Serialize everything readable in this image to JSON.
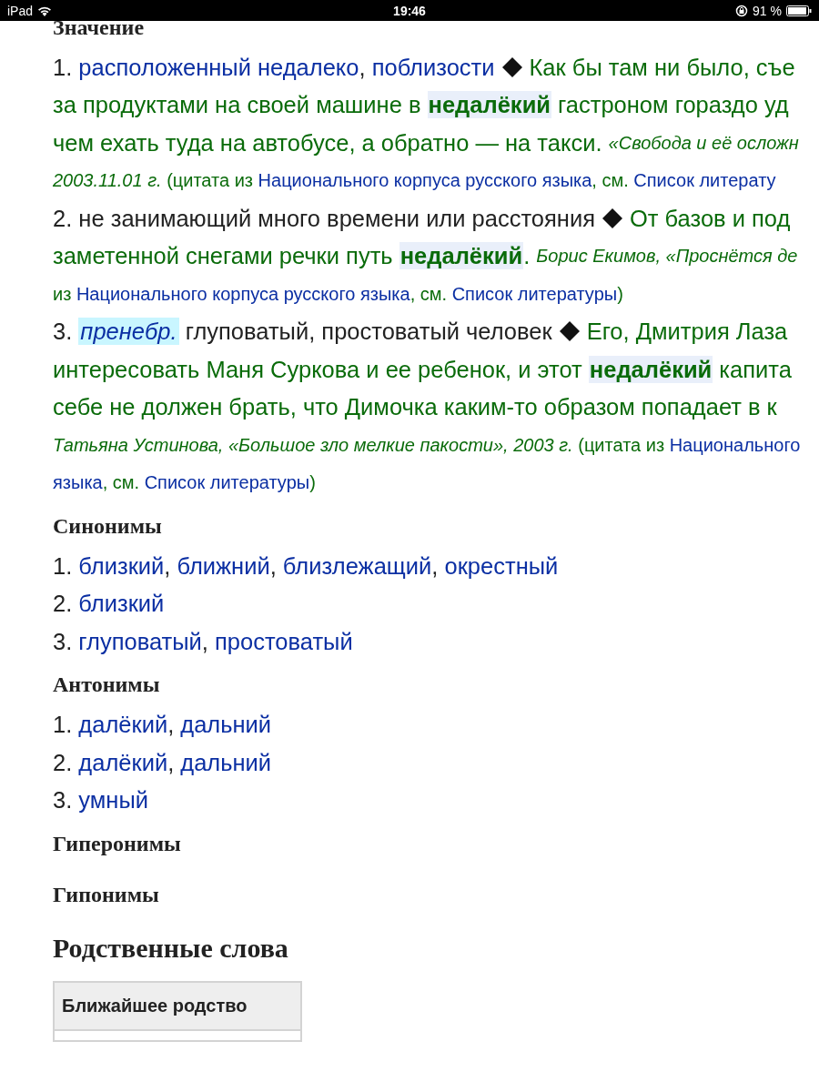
{
  "status_bar": {
    "device": "iPad",
    "time": "19:46",
    "battery": "91 %"
  },
  "sections": [
    {
      "kind": "h3",
      "title": "Значение",
      "lines": [
        {
          "kind": "text",
          "segments": [
            {
              "kind": "plain",
              "text": "1. "
            },
            {
              "kind": "link",
              "text": "расположенный недалеко"
            },
            {
              "kind": "plain",
              "text": ", "
            },
            {
              "kind": "link",
              "text": "поблизости"
            },
            {
              "kind": "marker"
            },
            {
              "kind": "quote",
              "text": "Как бы там ни было, съе"
            }
          ]
        },
        {
          "kind": "text",
          "segments": [
            {
              "kind": "quote",
              "text": "за продуктами на своей машине в "
            },
            {
              "kind": "term",
              "text": "недалёкий"
            },
            {
              "kind": "quote",
              "text": " гастроном гораздо уд"
            }
          ]
        },
        {
          "kind": "text",
          "segments": [
            {
              "kind": "quote",
              "text": "чем ехать туда на автобусе, а обратно — на такси. "
            },
            {
              "kind": "source",
              "text": "«Свобода и её осложн"
            }
          ]
        },
        {
          "kind": "citation",
          "segments": [
            {
              "kind": "source",
              "text": "2003.11.01 г."
            },
            {
              "kind": "quote",
              "text": " (цитата из "
            },
            {
              "kind": "link",
              "text": "Национального корпуса русского языка"
            },
            {
              "kind": "quote",
              "text": ", см. "
            },
            {
              "kind": "link",
              "text": "Список литерату"
            }
          ]
        },
        {
          "kind": "text",
          "segments": [
            {
              "kind": "plain",
              "text": "2. не занимающий много времени или расстояния"
            },
            {
              "kind": "marker"
            },
            {
              "kind": "quote",
              "text": "От базов и под"
            }
          ]
        },
        {
          "kind": "text",
          "segments": [
            {
              "kind": "quote",
              "text": "заметенной снегами речки путь "
            },
            {
              "kind": "term",
              "text": "недалёкий"
            },
            {
              "kind": "quote",
              "text": ". "
            },
            {
              "kind": "source",
              "text": "Борис Екимов, «Проснётся де"
            }
          ]
        },
        {
          "kind": "citation",
          "segments": [
            {
              "kind": "quote",
              "text": "из "
            },
            {
              "kind": "link",
              "text": "Национального корпуса русского языка"
            },
            {
              "kind": "quote",
              "text": ", см. "
            },
            {
              "kind": "link",
              "text": "Список литературы"
            },
            {
              "kind": "quote",
              "text": ")"
            }
          ]
        },
        {
          "kind": "text",
          "segments": [
            {
              "kind": "plain",
              "text": "3. "
            },
            {
              "kind": "label",
              "text": "пренебр."
            },
            {
              "kind": "plain",
              "text": " глуповатый, простоватый человек"
            },
            {
              "kind": "marker"
            },
            {
              "kind": "quote",
              "text": "Его, Дмитрия Лаза"
            }
          ]
        },
        {
          "kind": "text",
          "segments": [
            {
              "kind": "quote",
              "text": "интересовать Маня Суркова и ее ребенок, и этот "
            },
            {
              "kind": "term",
              "text": "недалёкий"
            },
            {
              "kind": "quote",
              "text": " капита"
            }
          ]
        },
        {
          "kind": "text",
          "segments": [
            {
              "kind": "quote",
              "text": "себе не должен брать, что Димочка каким-то образом попадает в к"
            }
          ]
        },
        {
          "kind": "citation",
          "segments": [
            {
              "kind": "source",
              "text": "Татьяна Устинова, «Большое зло мелкие пакости», 2003 г."
            },
            {
              "kind": "quote",
              "text": " (цитата из "
            },
            {
              "kind": "link",
              "text": "Национального"
            }
          ]
        },
        {
          "kind": "citation",
          "segments": [
            {
              "kind": "link",
              "text": "языка"
            },
            {
              "kind": "quote",
              "text": ", см. "
            },
            {
              "kind": "link",
              "text": "Список литературы"
            },
            {
              "kind": "quote",
              "text": ")"
            }
          ]
        }
      ]
    },
    {
      "kind": "h3",
      "title": "Синонимы",
      "lines": [
        {
          "kind": "text",
          "segments": [
            {
              "kind": "plain",
              "text": "1. "
            },
            {
              "kind": "link",
              "text": "близкий"
            },
            {
              "kind": "plain",
              "text": ", "
            },
            {
              "kind": "link",
              "text": "ближний"
            },
            {
              "kind": "plain",
              "text": ", "
            },
            {
              "kind": "link",
              "text": "близлежащий"
            },
            {
              "kind": "plain",
              "text": ", "
            },
            {
              "kind": "link",
              "text": "окрестный"
            }
          ]
        },
        {
          "kind": "text",
          "segments": [
            {
              "kind": "plain",
              "text": "2. "
            },
            {
              "kind": "link",
              "text": "близкий"
            }
          ]
        },
        {
          "kind": "text",
          "segments": [
            {
              "kind": "plain",
              "text": "3. "
            },
            {
              "kind": "link",
              "text": "глуповатый"
            },
            {
              "kind": "plain",
              "text": ", "
            },
            {
              "kind": "link",
              "text": "простоватый"
            }
          ]
        }
      ]
    },
    {
      "kind": "h3",
      "title": "Антонимы",
      "lines": [
        {
          "kind": "text",
          "segments": [
            {
              "kind": "plain",
              "text": "1. "
            },
            {
              "kind": "link",
              "text": "далёкий"
            },
            {
              "kind": "plain",
              "text": ", "
            },
            {
              "kind": "link",
              "text": "дальний"
            }
          ]
        },
        {
          "kind": "text",
          "segments": [
            {
              "kind": "plain",
              "text": "2. "
            },
            {
              "kind": "link",
              "text": "далёкий"
            },
            {
              "kind": "plain",
              "text": ", "
            },
            {
              "kind": "link",
              "text": "дальний"
            }
          ]
        },
        {
          "kind": "text",
          "segments": [
            {
              "kind": "plain",
              "text": "3. "
            },
            {
              "kind": "link",
              "text": "умный"
            }
          ]
        }
      ]
    },
    {
      "kind": "h3",
      "title": "Гиперонимы"
    },
    {
      "kind": "h3",
      "title": "Гипонимы"
    },
    {
      "kind": "h2",
      "title": "Родственные слова",
      "table": {
        "header": "Ближайшее родство"
      }
    }
  ]
}
